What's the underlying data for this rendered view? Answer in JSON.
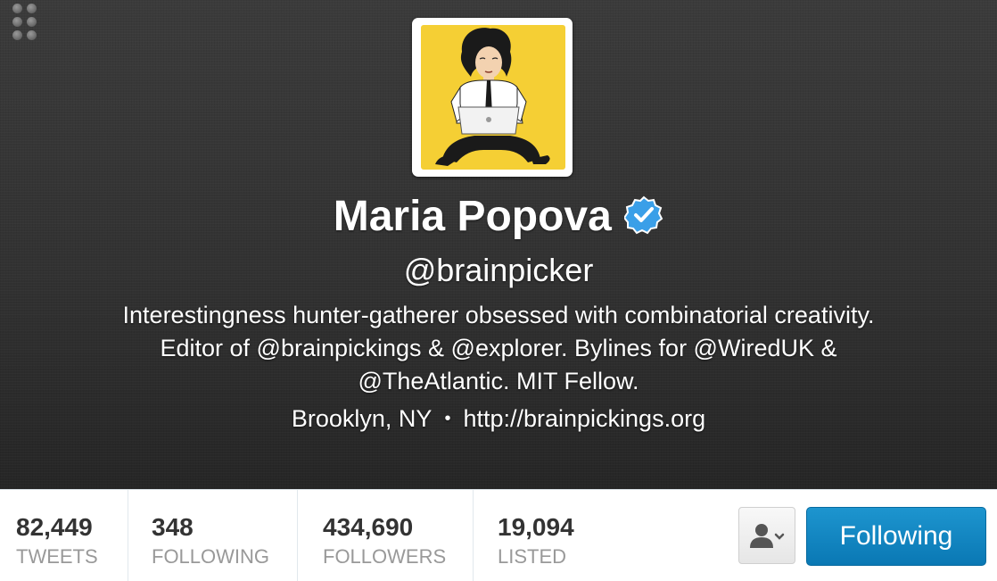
{
  "header": {
    "icons": {
      "apps": "grid-dots-icon",
      "verified": "verified-badge-icon",
      "avatar": "profile-avatar"
    },
    "name": "Maria Popova",
    "handle": "@brainpicker",
    "bio_lines": [
      "Interestingness hunter-gatherer obsessed with combinatorial creativity.",
      "Editor of @brainpickings & @explorer. Bylines for @WiredUK &",
      "@TheAtlantic. MIT Fellow."
    ],
    "location": "Brooklyn, NY",
    "separator": "•",
    "website": "http://brainpickings.org"
  },
  "stats": [
    {
      "count": "82,449",
      "label": "TWEETS"
    },
    {
      "count": "348",
      "label": "FOLLOWING"
    },
    {
      "count": "434,690",
      "label": "FOLLOWERS"
    },
    {
      "count": "19,094",
      "label": "LISTED"
    }
  ],
  "actions": {
    "user_menu_icon": "user-dropdown-icon",
    "follow_label": "Following"
  },
  "colors": {
    "header_bg": "#333333",
    "verified_blue": "#3a9fe8",
    "follow_button": "#1089c6",
    "avatar_bg": "#f5cf34",
    "stat_label": "#999999",
    "stat_count": "#333333"
  }
}
